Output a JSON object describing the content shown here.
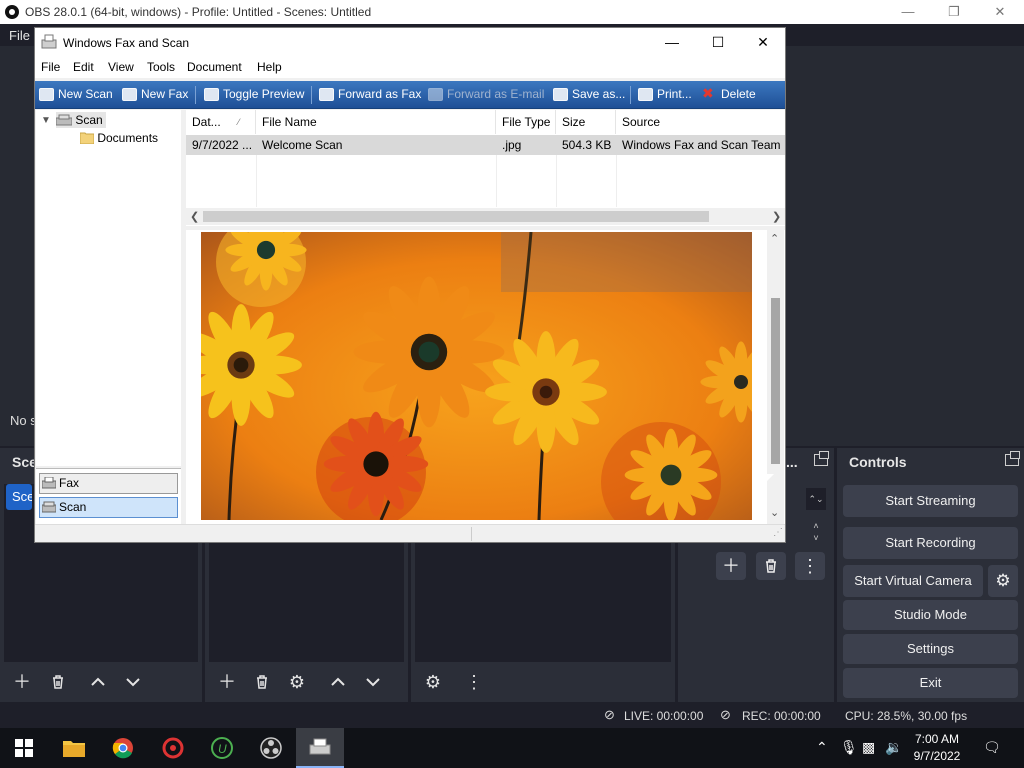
{
  "obs": {
    "title": "OBS 28.0.1 (64-bit, windows) - Profile: Untitled - Scenes: Untitled",
    "menu_file": "File",
    "no_source": "No s",
    "scenes_title": "Sce",
    "scene_item": "Sce",
    "audio_dock_title": "...",
    "controls": {
      "title": "Controls",
      "start_streaming": "Start Streaming",
      "start_recording": "Start Recording",
      "start_virtual_camera": "Start Virtual Camera",
      "studio_mode": "Studio Mode",
      "settings": "Settings",
      "exit": "Exit"
    },
    "status": {
      "live": "LIVE: 00:00:00",
      "rec": "REC: 00:00:00",
      "cpu": "CPU: 28.5%, 30.00 fps"
    }
  },
  "fax": {
    "title": "Windows Fax and Scan",
    "menu": [
      "File",
      "Edit",
      "View",
      "Tools",
      "Document",
      "Help"
    ],
    "toolbar": {
      "new_scan": "New Scan",
      "new_fax": "New Fax",
      "toggle_preview": "Toggle Preview",
      "forward_fax": "Forward as Fax",
      "forward_email": "Forward as E-mail",
      "save_as": "Save as...",
      "print": "Print...",
      "delete": "Delete"
    },
    "tree": {
      "root": "Scan",
      "child": "Documents"
    },
    "folders": {
      "fax": "Fax",
      "scan": "Scan"
    },
    "columns": [
      "Dat...",
      "File Name",
      "File Type",
      "Size",
      "Source"
    ],
    "row": {
      "date": "9/7/2022 ...",
      "name": "Welcome Scan",
      "type": ".jpg",
      "size": "504.3 KB",
      "source": "Windows Fax and Scan Team"
    }
  },
  "taskbar": {
    "time": "7:00 AM",
    "date": "9/7/2022"
  },
  "colors": {
    "obs_bg": "#1e1f29",
    "obs_dock": "#2b2e38",
    "obs_button": "#3c404d",
    "accent": "#1f63c7",
    "fax_toolbar": "#2a63ad"
  }
}
